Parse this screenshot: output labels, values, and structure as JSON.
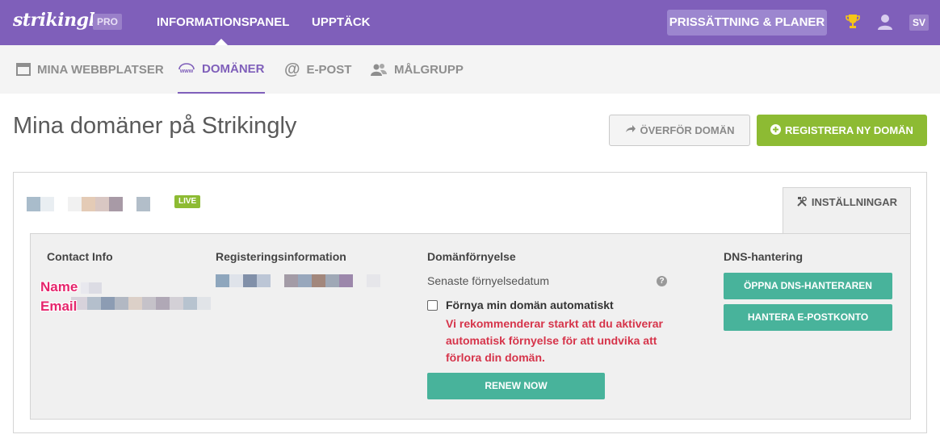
{
  "topbar": {
    "logo": "strikingly",
    "pro_badge": "PRO",
    "nav": [
      "INFORMATIONSPANEL",
      "UPPTÄCK"
    ],
    "pricing_button": "PRISSÄTTNING & PLANER",
    "trophy_icon": "trophy-icon",
    "user_icon": "user-icon",
    "language": "SV"
  },
  "subnav": {
    "items": [
      {
        "label": "MINA WEBBPLATSER",
        "icon": "browser-window-icon",
        "active": false
      },
      {
        "label": "DOMÄNER",
        "icon": "www-globe-icon",
        "active": true
      },
      {
        "label": "E-POST",
        "icon": "at-sign-icon",
        "active": false
      },
      {
        "label": "MÅLGRUPP",
        "icon": "users-icon",
        "active": false
      }
    ]
  },
  "page": {
    "title": "Mina domäner på Strikingly",
    "transfer_button": "ÖVERFÖR DOMÄN",
    "register_button": "REGISTRERA NY DOMÄN"
  },
  "domain": {
    "status_badge": "LIVE",
    "settings_tab": "INSTÄLLNINGAR",
    "contact": {
      "title": "Contact Info",
      "name_label": "Name",
      "email_label": "Email"
    },
    "registration": {
      "title": "Registeringsinformation"
    },
    "renewal": {
      "title": "Domänförnyelse",
      "latest_date_label": "Senaste förnyelsedatum",
      "auto_renew_label": "Förnya min domän automatiskt",
      "auto_renew_checked": false,
      "warning": "Vi rekommenderar starkt att du aktiverar automatisk förnyelse för att undvika att förlora din domän.",
      "renew_button": "RENEW NOW"
    },
    "dns": {
      "title": "DNS-hantering",
      "open_dns_button": "ÖPPNA DNS-HANTERAREN",
      "manage_email_button": "HANTERA E-POSTKONTO"
    }
  },
  "colors": {
    "brand_purple": "#7f5fba",
    "green": "#8dbb33",
    "teal": "#48b39b",
    "warning_red": "#d6344a"
  }
}
